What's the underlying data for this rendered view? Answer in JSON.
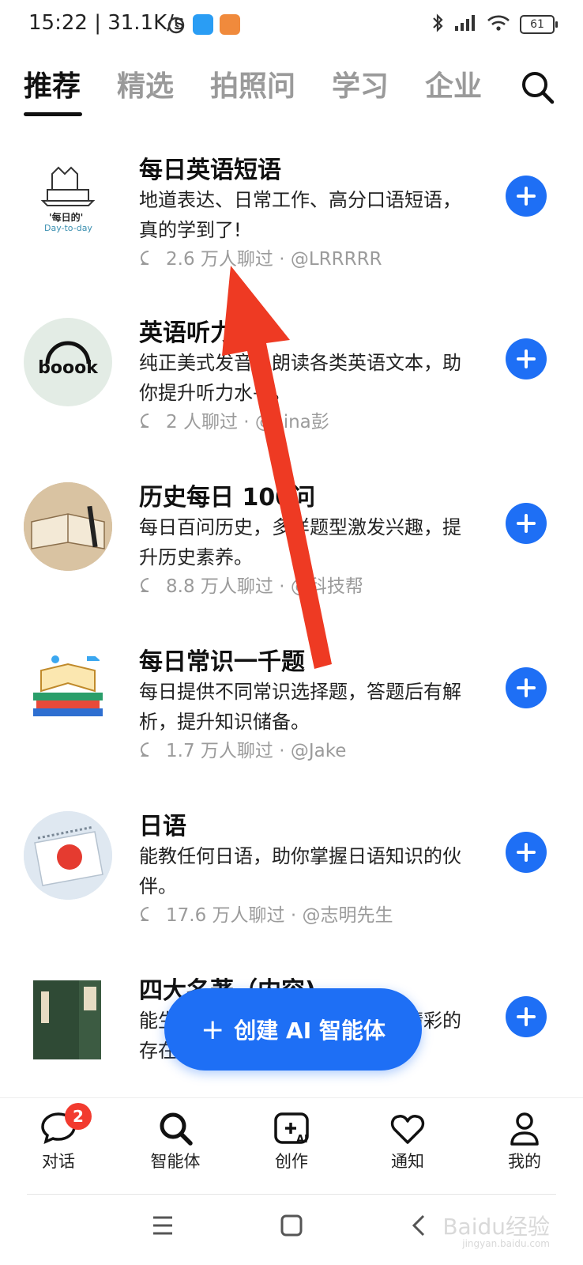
{
  "status_bar": {
    "time": "15:22 | 31.1K/s",
    "battery": "61"
  },
  "tabs": [
    {
      "label": "推荐",
      "active": true
    },
    {
      "label": "精选"
    },
    {
      "label": "拍照问"
    },
    {
      "label": "学习"
    },
    {
      "label": "企业"
    }
  ],
  "items": [
    {
      "title": "每日英语短语",
      "desc": "地道表达、日常工作、高分口语短语，真的学到了!",
      "meta": "2.6 万人聊过 · @LRRRRR",
      "avatar_text": "'每日的'",
      "avatar_sub": "Day-to-day"
    },
    {
      "title": "英语听力",
      "desc": "纯正美式发音，朗读各类英语文本，助你提升听力水平。",
      "meta": "2 人聊过 · @Lina彭",
      "avatar_text": "boook"
    },
    {
      "title": "历史每日 100问",
      "desc": "每日百问历史，多样题型激发兴趣，提升历史素养。",
      "meta": "8.8 万人聊过 · @科技帮"
    },
    {
      "title": "每日常识一千题",
      "desc": "每日提供不同常识选择题，答题后有解析，提升知识储备。",
      "meta": "1.7 万人聊过 · @Jake"
    },
    {
      "title": "日语",
      "desc": "能教任何日语，助你掌握日语知识的伙伴。",
      "meta": "17.6 万人聊过 · @志明先生"
    },
    {
      "title": "四大名著（内容)",
      "desc": "能生动讲述四大名著，领略其中精彩的存在",
      "meta": ""
    }
  ],
  "fab": {
    "label": "创建 AI 智能体"
  },
  "bottom_nav": [
    {
      "label": "对话",
      "badge": "2"
    },
    {
      "label": "智能体"
    },
    {
      "label": "创作"
    },
    {
      "label": "通知"
    },
    {
      "label": "我的"
    }
  ],
  "watermark": {
    "text": "Baidu经验",
    "sub": "jingyan.baidu.com"
  },
  "colors": {
    "accent": "#1e6ff5",
    "badge": "#f23b2f",
    "arrow": "#ee3a23"
  }
}
